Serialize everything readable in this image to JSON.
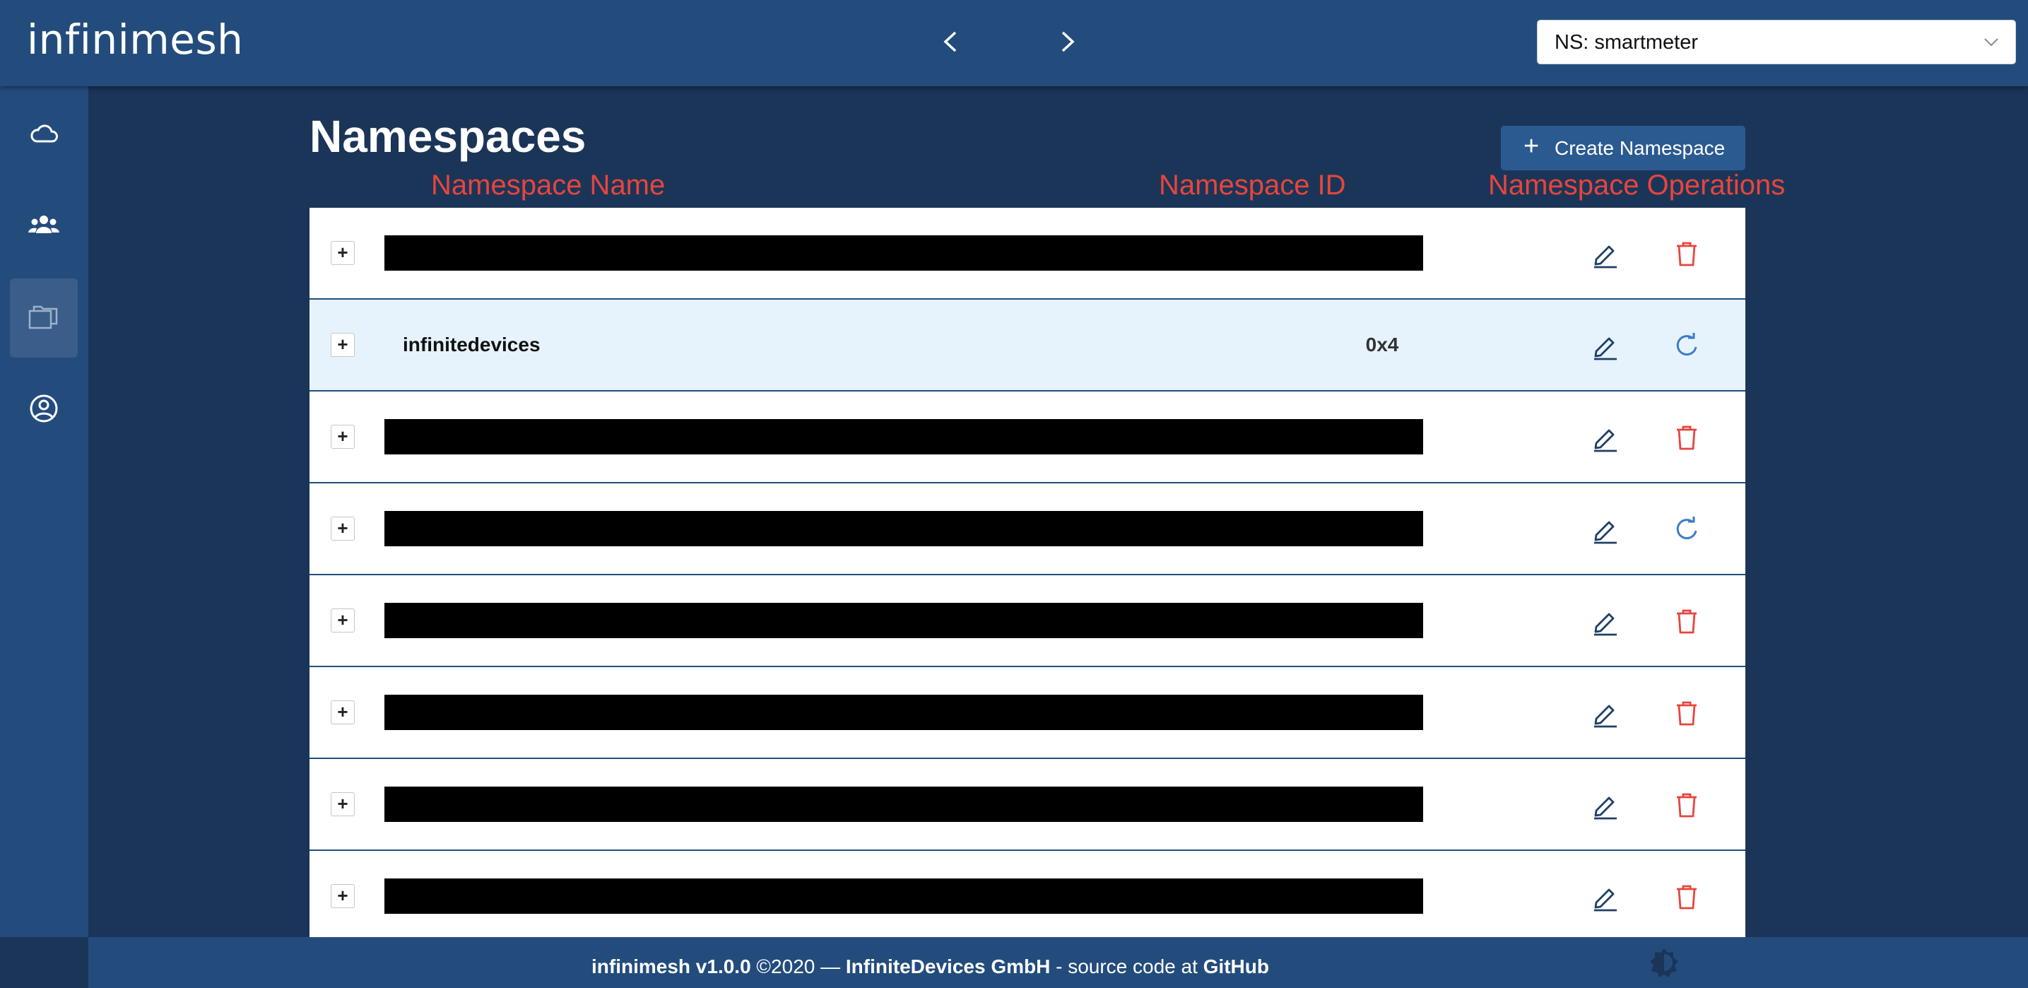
{
  "header": {
    "logo": "infinimesh",
    "namespace_select": {
      "value": "NS: smartmeter"
    }
  },
  "sidebar": {
    "items": [
      {
        "icon": "cloud-icon",
        "active": false
      },
      {
        "icon": "users-icon",
        "active": false
      },
      {
        "icon": "folders-icon",
        "active": true
      },
      {
        "icon": "account-icon",
        "active": false
      }
    ]
  },
  "main": {
    "title": "Namespaces",
    "create_button": {
      "icon": "plus-icon",
      "label": "Create Namespace"
    },
    "columns": {
      "name": "Namespace Name",
      "id": "Namespace ID",
      "operations": "Namespace Operations"
    },
    "rows": [
      {
        "expand": "+",
        "redacted": true,
        "name": "",
        "id": "",
        "second_op": "delete-icon"
      },
      {
        "expand": "+",
        "redacted": false,
        "name": "infinitedevices",
        "id": "0x4",
        "second_op": "restore-icon"
      },
      {
        "expand": "+",
        "redacted": true,
        "name": "",
        "id": "",
        "second_op": "delete-icon"
      },
      {
        "expand": "+",
        "redacted": true,
        "name": "",
        "id": "",
        "second_op": "restore-icon"
      },
      {
        "expand": "+",
        "redacted": true,
        "name": "",
        "id": "",
        "second_op": "delete-icon"
      },
      {
        "expand": "+",
        "redacted": true,
        "name": "",
        "id": "",
        "second_op": "delete-icon"
      },
      {
        "expand": "+",
        "redacted": true,
        "name": "",
        "id": "",
        "second_op": "delete-icon"
      },
      {
        "expand": "+",
        "redacted": true,
        "name": "",
        "id": "",
        "second_op": "delete-icon"
      }
    ]
  },
  "footer": {
    "product": "infinimesh v1.0.0",
    "copyright": " ©2020 — ",
    "company": "InfiniteDevices GmbH",
    "source_text": " - source code at ",
    "source_link": "GitHub"
  },
  "colors": {
    "header": "#234c7d",
    "background": "#1b3558",
    "accent_red": "#e8453c",
    "row_highlight": "#e6f3fc"
  }
}
